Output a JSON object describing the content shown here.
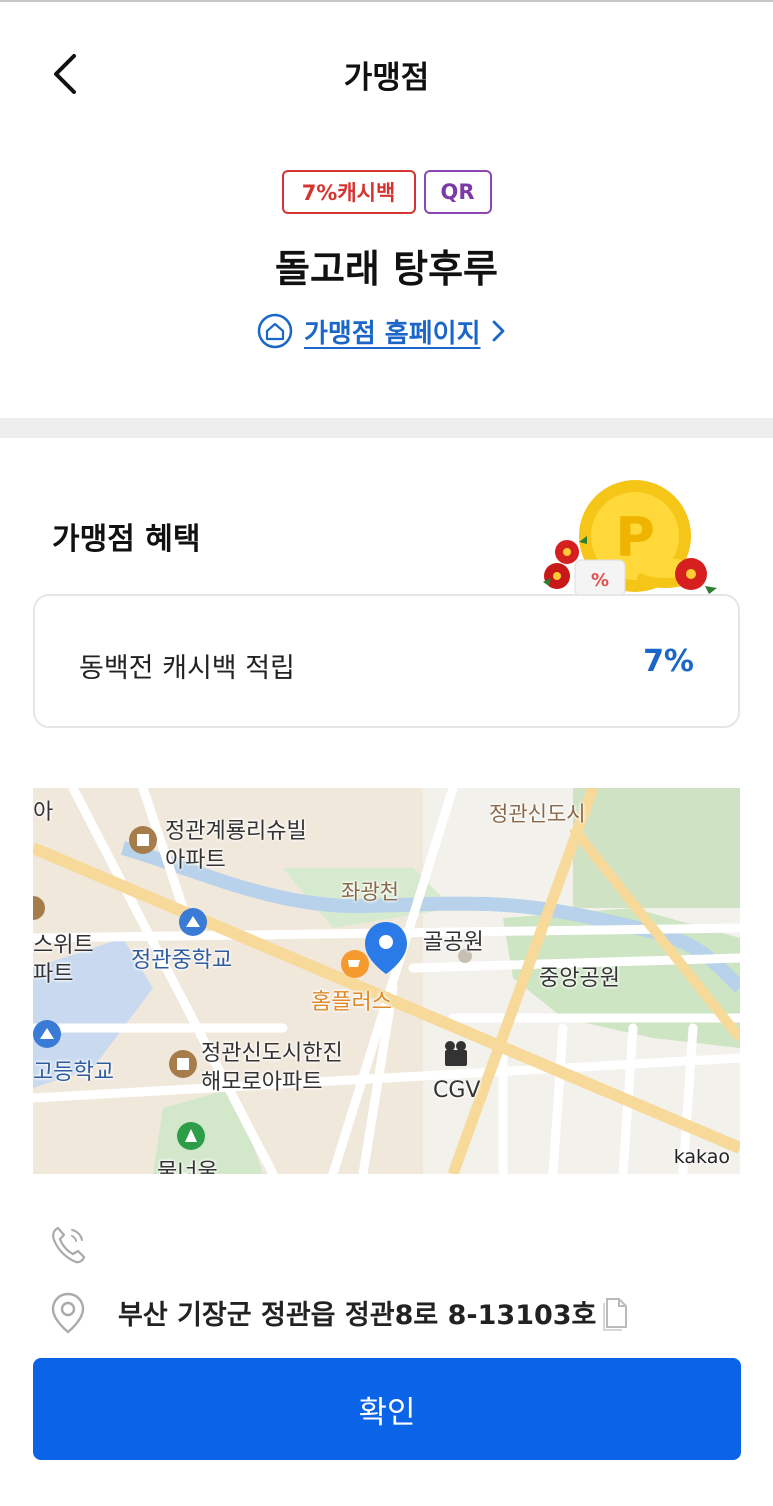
{
  "header": {
    "title": "가맹점"
  },
  "store": {
    "badges": {
      "cashback": "7%캐시백",
      "qr": "QR"
    },
    "name": "돌고래 탕후루",
    "homepage_label": "가맹점 홈페이지"
  },
  "benefits": {
    "title": "가맹점 혜택",
    "items": [
      {
        "label": "동백전 캐시백 적립",
        "value": "7%"
      }
    ]
  },
  "map": {
    "labels": {
      "apt1": "정관계룡리슈빌\n아파트",
      "jeonggwan_newtown": "정관신도시",
      "jwagwangcheon": "좌광천",
      "park_partial": "골공원",
      "central_park": "중앙공원",
      "school_middle": "정관중학교",
      "apt_partial_left": "스위트\n파트",
      "home_plus": "홈플러스",
      "apt2": "정관신도시한진\n해모로아파트",
      "cgv": "CGV",
      "school_high_partial": "고등학교",
      "forest_partial": "물너울",
      "edge_partial": "아",
      "provider": "kakao"
    }
  },
  "contact": {
    "phone": "",
    "address": "부산 기장군 정관읍 정관8로 8-13103호"
  },
  "actions": {
    "confirm_label": "확인"
  },
  "colors": {
    "primary": "#0b63e8",
    "accent_blue": "#1b67c9",
    "cashback_red": "#d63431",
    "qr_purple": "#8b48b5"
  }
}
